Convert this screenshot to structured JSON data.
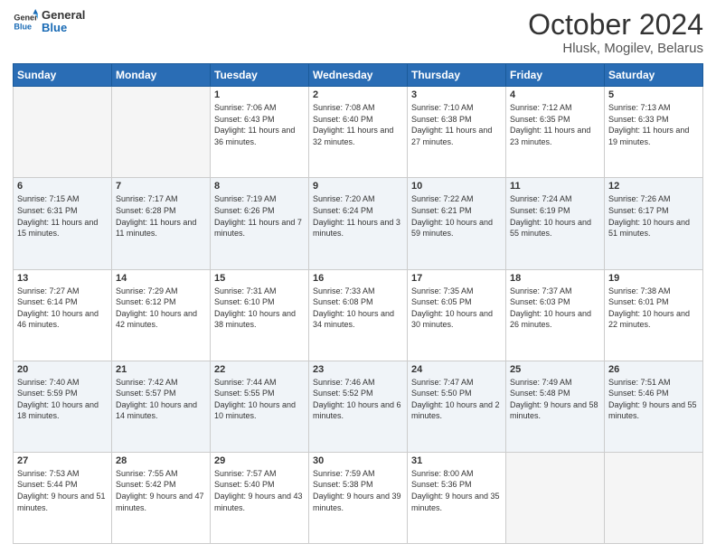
{
  "header": {
    "logo_line1": "General",
    "logo_line2": "Blue",
    "month": "October 2024",
    "location": "Hlusk, Mogilev, Belarus"
  },
  "weekdays": [
    "Sunday",
    "Monday",
    "Tuesday",
    "Wednesday",
    "Thursday",
    "Friday",
    "Saturday"
  ],
  "weeks": [
    [
      {
        "day": "",
        "info": ""
      },
      {
        "day": "",
        "info": ""
      },
      {
        "day": "1",
        "info": "Sunrise: 7:06 AM\nSunset: 6:43 PM\nDaylight: 11 hours and 36 minutes."
      },
      {
        "day": "2",
        "info": "Sunrise: 7:08 AM\nSunset: 6:40 PM\nDaylight: 11 hours and 32 minutes."
      },
      {
        "day": "3",
        "info": "Sunrise: 7:10 AM\nSunset: 6:38 PM\nDaylight: 11 hours and 27 minutes."
      },
      {
        "day": "4",
        "info": "Sunrise: 7:12 AM\nSunset: 6:35 PM\nDaylight: 11 hours and 23 minutes."
      },
      {
        "day": "5",
        "info": "Sunrise: 7:13 AM\nSunset: 6:33 PM\nDaylight: 11 hours and 19 minutes."
      }
    ],
    [
      {
        "day": "6",
        "info": "Sunrise: 7:15 AM\nSunset: 6:31 PM\nDaylight: 11 hours and 15 minutes."
      },
      {
        "day": "7",
        "info": "Sunrise: 7:17 AM\nSunset: 6:28 PM\nDaylight: 11 hours and 11 minutes."
      },
      {
        "day": "8",
        "info": "Sunrise: 7:19 AM\nSunset: 6:26 PM\nDaylight: 11 hours and 7 minutes."
      },
      {
        "day": "9",
        "info": "Sunrise: 7:20 AM\nSunset: 6:24 PM\nDaylight: 11 hours and 3 minutes."
      },
      {
        "day": "10",
        "info": "Sunrise: 7:22 AM\nSunset: 6:21 PM\nDaylight: 10 hours and 59 minutes."
      },
      {
        "day": "11",
        "info": "Sunrise: 7:24 AM\nSunset: 6:19 PM\nDaylight: 10 hours and 55 minutes."
      },
      {
        "day": "12",
        "info": "Sunrise: 7:26 AM\nSunset: 6:17 PM\nDaylight: 10 hours and 51 minutes."
      }
    ],
    [
      {
        "day": "13",
        "info": "Sunrise: 7:27 AM\nSunset: 6:14 PM\nDaylight: 10 hours and 46 minutes."
      },
      {
        "day": "14",
        "info": "Sunrise: 7:29 AM\nSunset: 6:12 PM\nDaylight: 10 hours and 42 minutes."
      },
      {
        "day": "15",
        "info": "Sunrise: 7:31 AM\nSunset: 6:10 PM\nDaylight: 10 hours and 38 minutes."
      },
      {
        "day": "16",
        "info": "Sunrise: 7:33 AM\nSunset: 6:08 PM\nDaylight: 10 hours and 34 minutes."
      },
      {
        "day": "17",
        "info": "Sunrise: 7:35 AM\nSunset: 6:05 PM\nDaylight: 10 hours and 30 minutes."
      },
      {
        "day": "18",
        "info": "Sunrise: 7:37 AM\nSunset: 6:03 PM\nDaylight: 10 hours and 26 minutes."
      },
      {
        "day": "19",
        "info": "Sunrise: 7:38 AM\nSunset: 6:01 PM\nDaylight: 10 hours and 22 minutes."
      }
    ],
    [
      {
        "day": "20",
        "info": "Sunrise: 7:40 AM\nSunset: 5:59 PM\nDaylight: 10 hours and 18 minutes."
      },
      {
        "day": "21",
        "info": "Sunrise: 7:42 AM\nSunset: 5:57 PM\nDaylight: 10 hours and 14 minutes."
      },
      {
        "day": "22",
        "info": "Sunrise: 7:44 AM\nSunset: 5:55 PM\nDaylight: 10 hours and 10 minutes."
      },
      {
        "day": "23",
        "info": "Sunrise: 7:46 AM\nSunset: 5:52 PM\nDaylight: 10 hours and 6 minutes."
      },
      {
        "day": "24",
        "info": "Sunrise: 7:47 AM\nSunset: 5:50 PM\nDaylight: 10 hours and 2 minutes."
      },
      {
        "day": "25",
        "info": "Sunrise: 7:49 AM\nSunset: 5:48 PM\nDaylight: 9 hours and 58 minutes."
      },
      {
        "day": "26",
        "info": "Sunrise: 7:51 AM\nSunset: 5:46 PM\nDaylight: 9 hours and 55 minutes."
      }
    ],
    [
      {
        "day": "27",
        "info": "Sunrise: 7:53 AM\nSunset: 5:44 PM\nDaylight: 9 hours and 51 minutes."
      },
      {
        "day": "28",
        "info": "Sunrise: 7:55 AM\nSunset: 5:42 PM\nDaylight: 9 hours and 47 minutes."
      },
      {
        "day": "29",
        "info": "Sunrise: 7:57 AM\nSunset: 5:40 PM\nDaylight: 9 hours and 43 minutes."
      },
      {
        "day": "30",
        "info": "Sunrise: 7:59 AM\nSunset: 5:38 PM\nDaylight: 9 hours and 39 minutes."
      },
      {
        "day": "31",
        "info": "Sunrise: 8:00 AM\nSunset: 5:36 PM\nDaylight: 9 hours and 35 minutes."
      },
      {
        "day": "",
        "info": ""
      },
      {
        "day": "",
        "info": ""
      }
    ]
  ]
}
